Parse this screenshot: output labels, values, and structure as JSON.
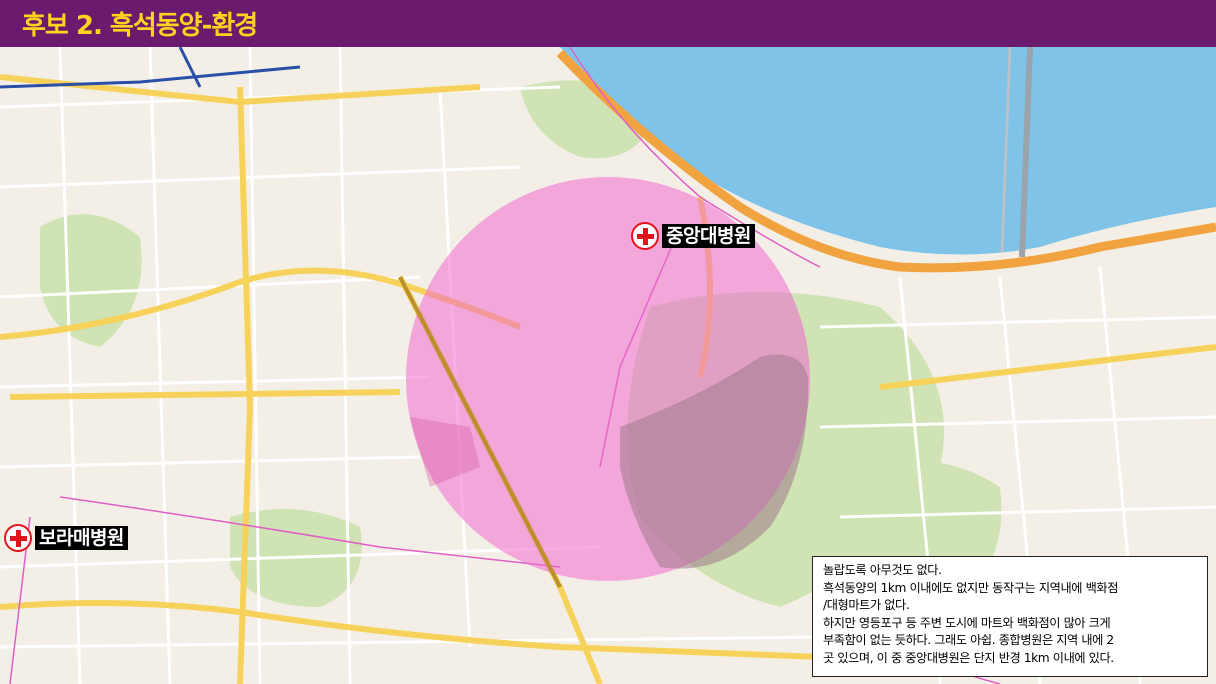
{
  "header": {
    "title": "후보 2. 흑석동양-환경"
  },
  "map": {
    "colors": {
      "land": "#f3efe6",
      "river": "#7fc3e8",
      "park": "#cfe3b4",
      "road_major": "#f7d25b",
      "road_minor": "#ffffff",
      "rail": "#2a4fa8",
      "radius_fill": "#f06ad0",
      "boundary": "#e05fc6"
    },
    "markers": [
      {
        "name": "중앙대병원",
        "icon": "hospital-cross-icon"
      },
      {
        "name": "보라매병원",
        "icon": "hospital-cross-icon"
      }
    ]
  },
  "note": {
    "lines": [
      "놀랍도록 아무것도 없다.",
      "흑석동양의 1km 이내에도 없지만 동작구는 지역내에  백화점",
      "/대형마트가 없다.",
      "하지만 영등포구 등 주변 도시에 마트와 백화점이 많아 크게",
      "부족함이 없는 듯하다. 그래도 아쉽. 종합병원은 지역 내에 2",
      "곳 있으며, 이 중 중앙대병원은 단지 반경 1km 이내에 있다."
    ]
  }
}
